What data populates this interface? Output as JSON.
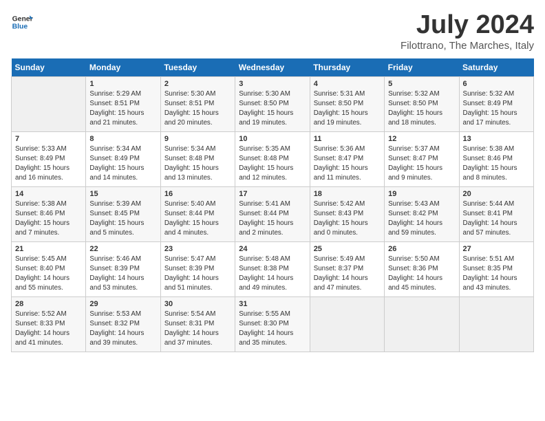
{
  "header": {
    "logo_general": "General",
    "logo_blue": "Blue",
    "month_title": "July 2024",
    "location": "Filottrano, The Marches, Italy"
  },
  "days_of_week": [
    "Sunday",
    "Monday",
    "Tuesday",
    "Wednesday",
    "Thursday",
    "Friday",
    "Saturday"
  ],
  "weeks": [
    [
      {
        "day": "",
        "info": ""
      },
      {
        "day": "1",
        "info": "Sunrise: 5:29 AM\nSunset: 8:51 PM\nDaylight: 15 hours\nand 21 minutes."
      },
      {
        "day": "2",
        "info": "Sunrise: 5:30 AM\nSunset: 8:51 PM\nDaylight: 15 hours\nand 20 minutes."
      },
      {
        "day": "3",
        "info": "Sunrise: 5:30 AM\nSunset: 8:50 PM\nDaylight: 15 hours\nand 19 minutes."
      },
      {
        "day": "4",
        "info": "Sunrise: 5:31 AM\nSunset: 8:50 PM\nDaylight: 15 hours\nand 19 minutes."
      },
      {
        "day": "5",
        "info": "Sunrise: 5:32 AM\nSunset: 8:50 PM\nDaylight: 15 hours\nand 18 minutes."
      },
      {
        "day": "6",
        "info": "Sunrise: 5:32 AM\nSunset: 8:49 PM\nDaylight: 15 hours\nand 17 minutes."
      }
    ],
    [
      {
        "day": "7",
        "info": "Sunrise: 5:33 AM\nSunset: 8:49 PM\nDaylight: 15 hours\nand 16 minutes."
      },
      {
        "day": "8",
        "info": "Sunrise: 5:34 AM\nSunset: 8:49 PM\nDaylight: 15 hours\nand 14 minutes."
      },
      {
        "day": "9",
        "info": "Sunrise: 5:34 AM\nSunset: 8:48 PM\nDaylight: 15 hours\nand 13 minutes."
      },
      {
        "day": "10",
        "info": "Sunrise: 5:35 AM\nSunset: 8:48 PM\nDaylight: 15 hours\nand 12 minutes."
      },
      {
        "day": "11",
        "info": "Sunrise: 5:36 AM\nSunset: 8:47 PM\nDaylight: 15 hours\nand 11 minutes."
      },
      {
        "day": "12",
        "info": "Sunrise: 5:37 AM\nSunset: 8:47 PM\nDaylight: 15 hours\nand 9 minutes."
      },
      {
        "day": "13",
        "info": "Sunrise: 5:38 AM\nSunset: 8:46 PM\nDaylight: 15 hours\nand 8 minutes."
      }
    ],
    [
      {
        "day": "14",
        "info": "Sunrise: 5:38 AM\nSunset: 8:46 PM\nDaylight: 15 hours\nand 7 minutes."
      },
      {
        "day": "15",
        "info": "Sunrise: 5:39 AM\nSunset: 8:45 PM\nDaylight: 15 hours\nand 5 minutes."
      },
      {
        "day": "16",
        "info": "Sunrise: 5:40 AM\nSunset: 8:44 PM\nDaylight: 15 hours\nand 4 minutes."
      },
      {
        "day": "17",
        "info": "Sunrise: 5:41 AM\nSunset: 8:44 PM\nDaylight: 15 hours\nand 2 minutes."
      },
      {
        "day": "18",
        "info": "Sunrise: 5:42 AM\nSunset: 8:43 PM\nDaylight: 15 hours\nand 0 minutes."
      },
      {
        "day": "19",
        "info": "Sunrise: 5:43 AM\nSunset: 8:42 PM\nDaylight: 14 hours\nand 59 minutes."
      },
      {
        "day": "20",
        "info": "Sunrise: 5:44 AM\nSunset: 8:41 PM\nDaylight: 14 hours\nand 57 minutes."
      }
    ],
    [
      {
        "day": "21",
        "info": "Sunrise: 5:45 AM\nSunset: 8:40 PM\nDaylight: 14 hours\nand 55 minutes."
      },
      {
        "day": "22",
        "info": "Sunrise: 5:46 AM\nSunset: 8:39 PM\nDaylight: 14 hours\nand 53 minutes."
      },
      {
        "day": "23",
        "info": "Sunrise: 5:47 AM\nSunset: 8:39 PM\nDaylight: 14 hours\nand 51 minutes."
      },
      {
        "day": "24",
        "info": "Sunrise: 5:48 AM\nSunset: 8:38 PM\nDaylight: 14 hours\nand 49 minutes."
      },
      {
        "day": "25",
        "info": "Sunrise: 5:49 AM\nSunset: 8:37 PM\nDaylight: 14 hours\nand 47 minutes."
      },
      {
        "day": "26",
        "info": "Sunrise: 5:50 AM\nSunset: 8:36 PM\nDaylight: 14 hours\nand 45 minutes."
      },
      {
        "day": "27",
        "info": "Sunrise: 5:51 AM\nSunset: 8:35 PM\nDaylight: 14 hours\nand 43 minutes."
      }
    ],
    [
      {
        "day": "28",
        "info": "Sunrise: 5:52 AM\nSunset: 8:33 PM\nDaylight: 14 hours\nand 41 minutes."
      },
      {
        "day": "29",
        "info": "Sunrise: 5:53 AM\nSunset: 8:32 PM\nDaylight: 14 hours\nand 39 minutes."
      },
      {
        "day": "30",
        "info": "Sunrise: 5:54 AM\nSunset: 8:31 PM\nDaylight: 14 hours\nand 37 minutes."
      },
      {
        "day": "31",
        "info": "Sunrise: 5:55 AM\nSunset: 8:30 PM\nDaylight: 14 hours\nand 35 minutes."
      },
      {
        "day": "",
        "info": ""
      },
      {
        "day": "",
        "info": ""
      },
      {
        "day": "",
        "info": ""
      }
    ]
  ]
}
